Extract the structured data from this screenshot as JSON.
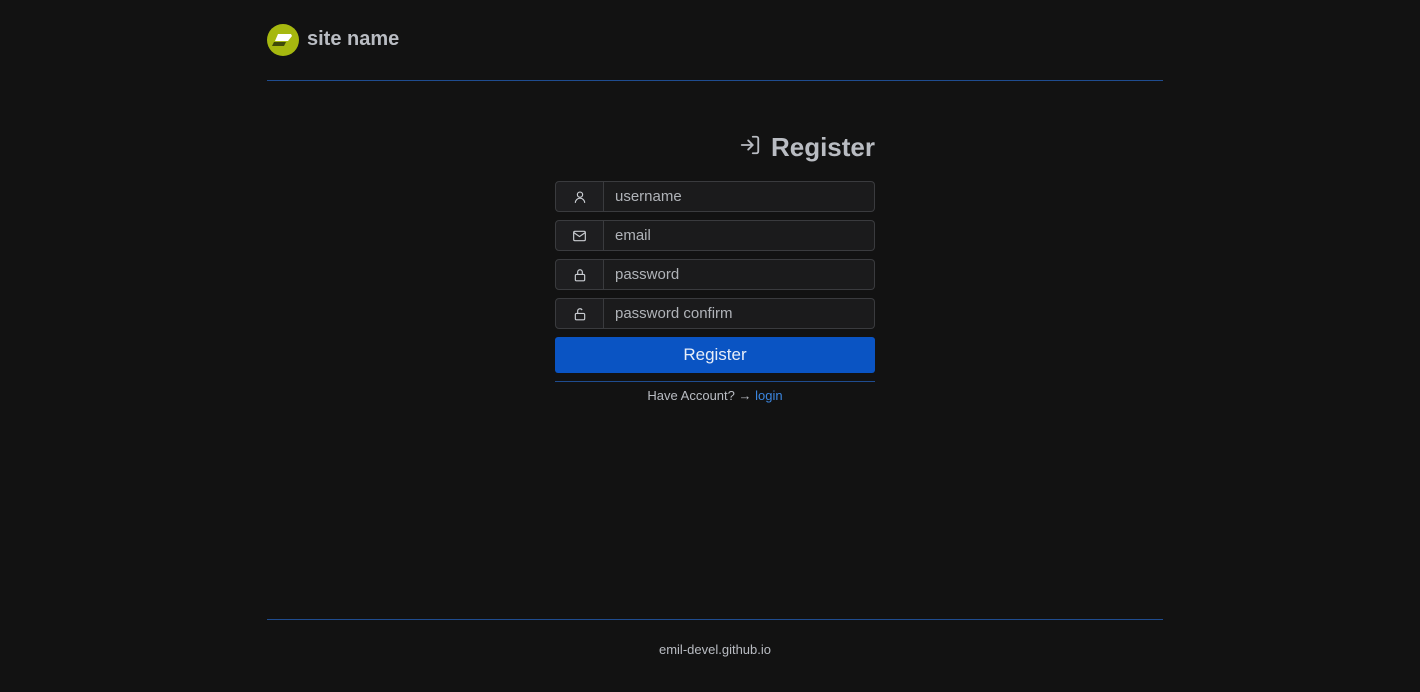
{
  "header": {
    "site_name": "site name",
    "logo_icon": "logo-icon",
    "logo_color": "#a6b80f"
  },
  "form": {
    "title": "Register",
    "title_icon": "login-arrow-icon",
    "fields": [
      {
        "name": "username",
        "placeholder": "username",
        "value": "",
        "icon": "user-icon"
      },
      {
        "name": "email",
        "placeholder": "email",
        "value": "",
        "icon": "envelope-icon"
      },
      {
        "name": "password",
        "placeholder": "password",
        "value": "",
        "icon": "lock-icon"
      },
      {
        "name": "password-confirm",
        "placeholder": "password confirm",
        "value": "",
        "icon": "unlock-icon"
      }
    ],
    "submit_label": "Register",
    "accent_color": "#0a54c3",
    "have_account_text": "Have Account? →",
    "login_link": "login"
  },
  "footer": {
    "text": "emil-devel.github.io"
  }
}
